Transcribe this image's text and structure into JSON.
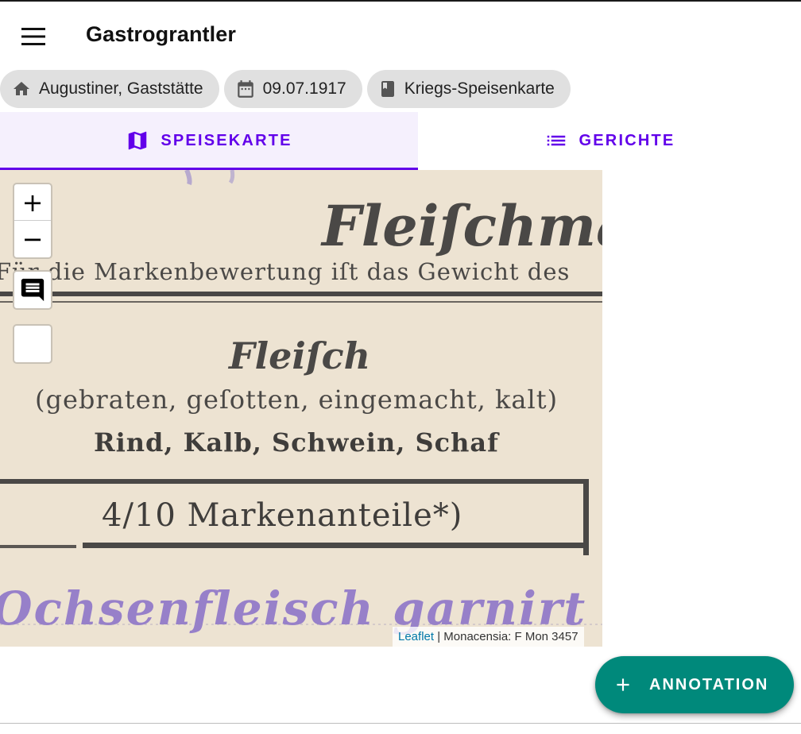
{
  "app": {
    "title": "Gastrograntler",
    "menu_icon": "hamburger-menu-icon"
  },
  "chips": [
    {
      "icon": "home-icon",
      "label": "Augustiner, Gaststätte"
    },
    {
      "icon": "calendar-icon",
      "label": "09.07.1917"
    },
    {
      "icon": "book-icon",
      "label": "Kriegs-Speisenkarte"
    }
  ],
  "tabs": [
    {
      "icon": "map-icon",
      "label": "SPEISEKARTE",
      "active": true
    },
    {
      "icon": "list-icon",
      "label": "GERICHTE",
      "active": false
    }
  ],
  "map": {
    "zoom_in": "+",
    "zoom_out": "−",
    "comment_icon": "comment-icon",
    "attribution_link": "Leaflet",
    "attribution_separator": " | ",
    "attribution_source": "Monacensia: F Mon 3457",
    "scan_text": {
      "heading": "Fleiſchmar",
      "subline": "Für die Markenbewertung iſt das Gewicht des",
      "section_title": "Fleiſch",
      "section_detail": "(gebraten, geſotten, eingemacht, kalt)",
      "section_kinds": "Rind, Kalb, Schwein, Schaf",
      "ration": "4/10 Markenanteile*)",
      "handwriting": "Ochsenfleisch garnirt Ko"
    }
  },
  "fab": {
    "icon": "plus-icon",
    "label": "ANNOTATION"
  },
  "colors": {
    "accent": "#6200ea",
    "fab": "#00897b",
    "chip_bg": "#e0e0e0",
    "paper": "#ede3d2",
    "ink": "#3a3a3a",
    "handwriting": "#7b5fc7"
  }
}
